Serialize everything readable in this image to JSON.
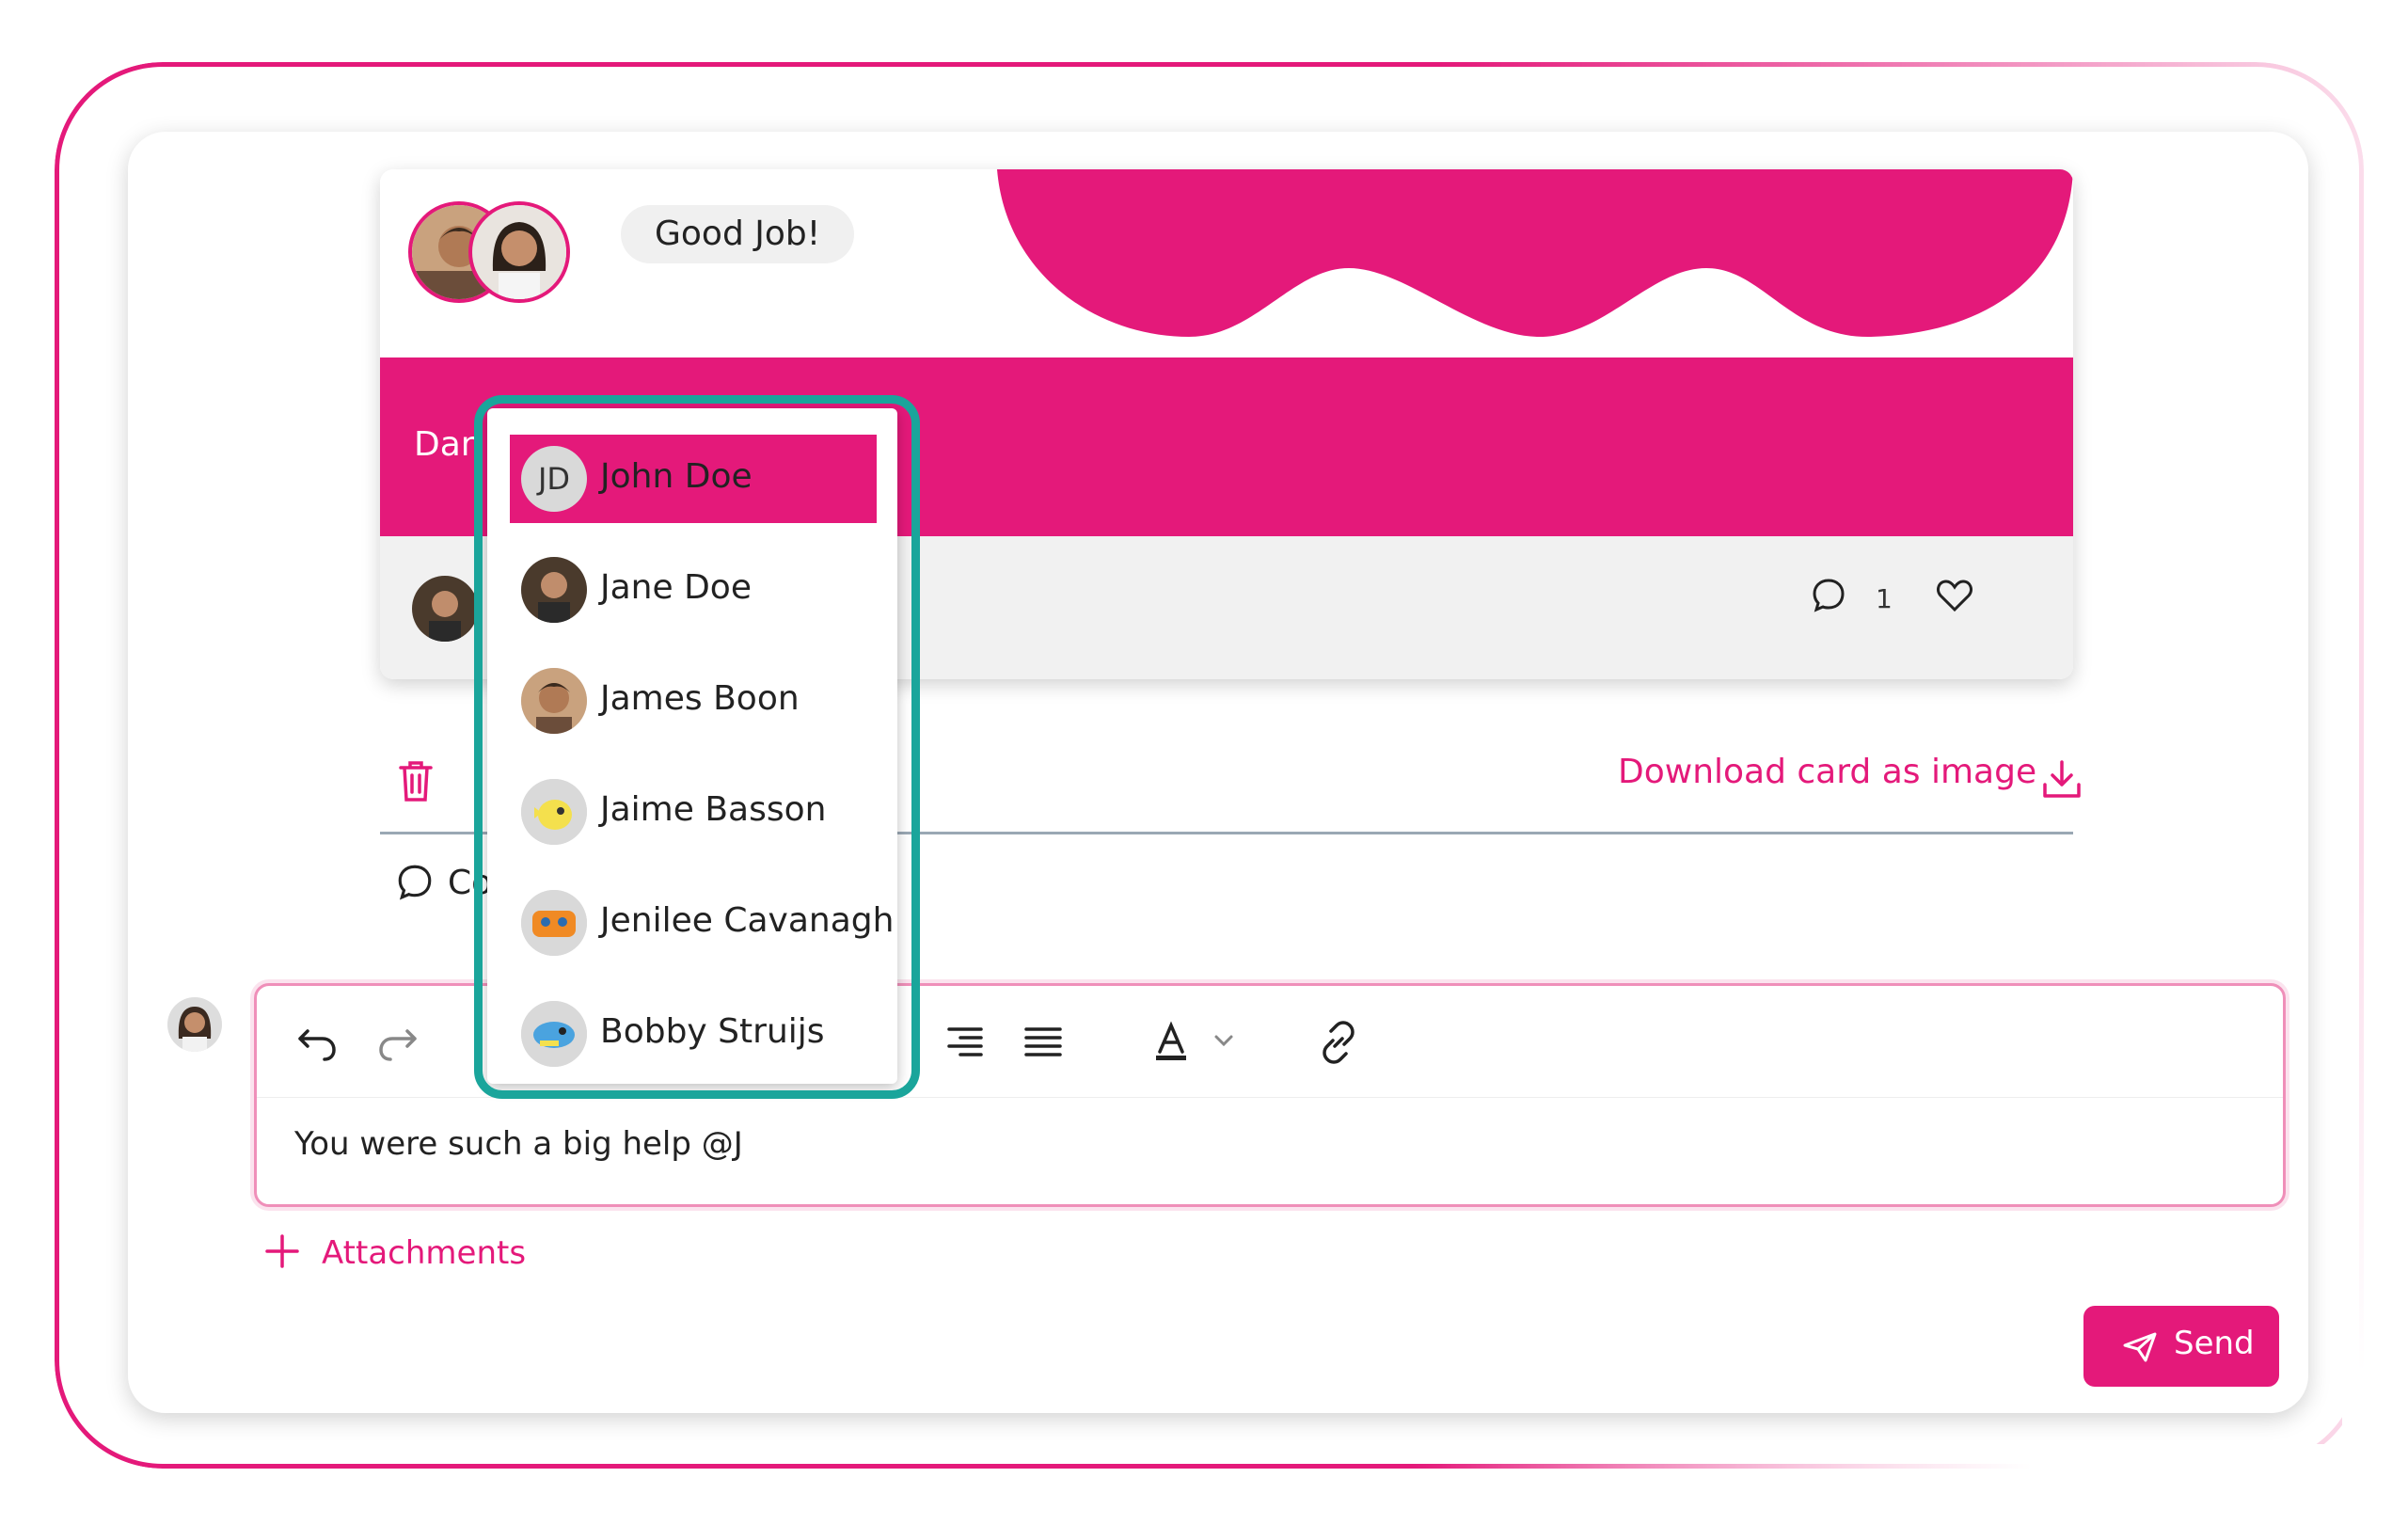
{
  "card": {
    "tag": "Good Job!",
    "band_text": "Dan",
    "comment_count": "1"
  },
  "actions": {
    "download_label": "Download card as image",
    "comments_label": "Co"
  },
  "editor": {
    "text": "You were such a big help @J",
    "toolbar": [
      "undo",
      "redo",
      "align-right",
      "justify",
      "text-color",
      "link"
    ]
  },
  "attachments_label": "Attachments",
  "send_label": "Send",
  "mention_dropdown": {
    "items": [
      {
        "name": "John Doe",
        "initials": "JD",
        "active": true
      },
      {
        "name": "Jane Doe"
      },
      {
        "name": "James Boon"
      },
      {
        "name": "Jaime Basson"
      },
      {
        "name": "Jenilee Cavanagh"
      },
      {
        "name": "Bobby Struijs"
      }
    ]
  },
  "colors": {
    "brand": "#e4197a",
    "highlight_outline": "#1aa59b"
  }
}
